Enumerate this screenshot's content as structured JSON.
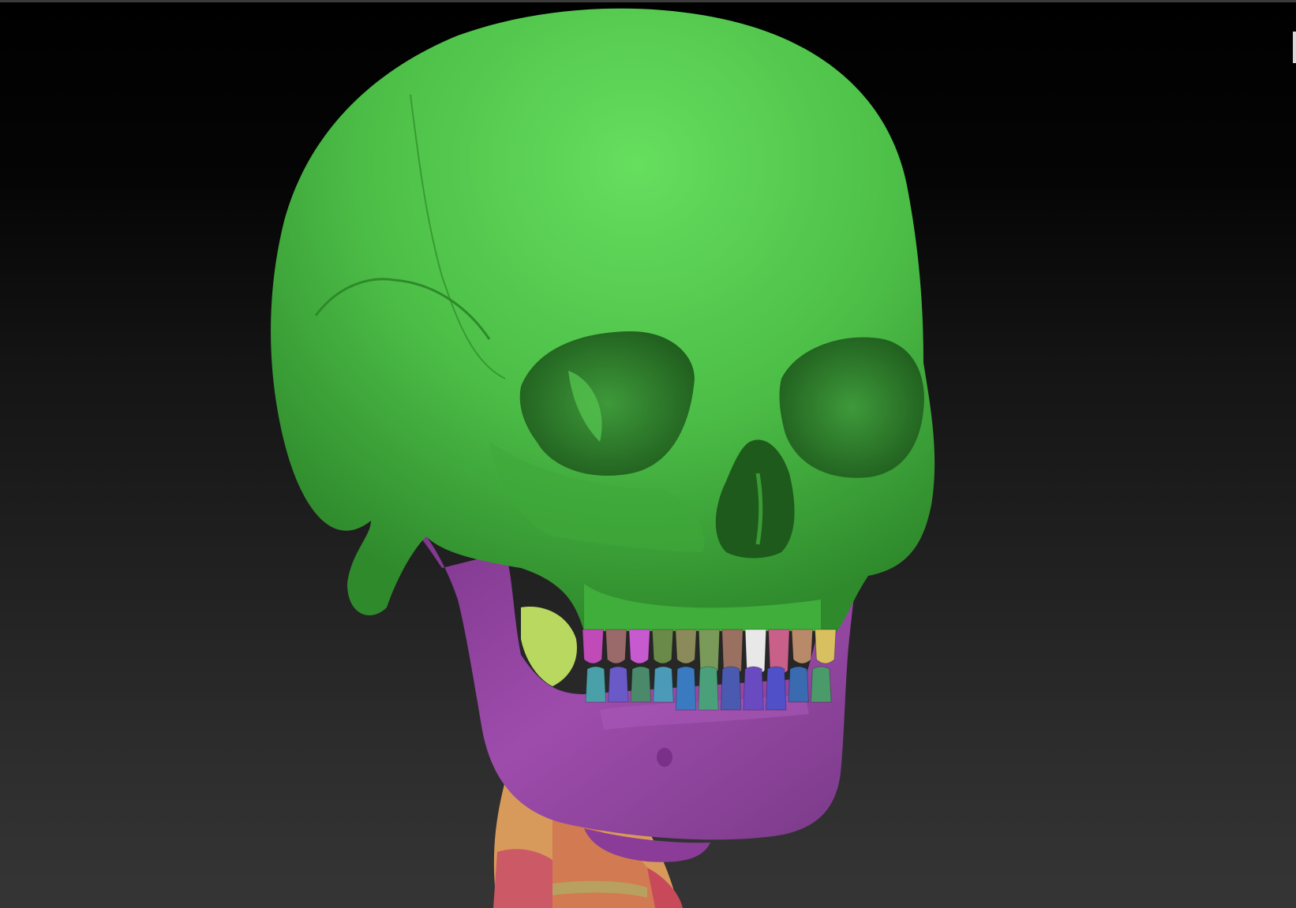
{
  "viewport": {
    "subject": "3D skull model",
    "background_top": "#000000",
    "background_bottom": "#353535"
  },
  "model": {
    "cranium_color": "#4fc44a",
    "mandible_color": "#9a4aa8",
    "vertebra_colors": [
      "#e08a5a",
      "#c85a6a",
      "#d8a04a",
      "#c0a060"
    ],
    "upper_teeth_colors": [
      "#c04ab8",
      "#9a6a6a",
      "#c85ad0",
      "#6a8a4a",
      "#8a8a5a",
      "#7a9a5a",
      "#9a7060",
      "#e8e8e8",
      "#c8608a",
      "#b88a6a",
      "#d8c060"
    ],
    "lower_teeth_colors": [
      "#4aa0a8",
      "#6a5ac8",
      "#4a8a6a",
      "#4a9ab8",
      "#3a7ac0",
      "#4aa07a",
      "#4a5ab0",
      "#6a4ac0",
      "#5050c8",
      "#3a6ab0",
      "#4a9a6a"
    ]
  }
}
